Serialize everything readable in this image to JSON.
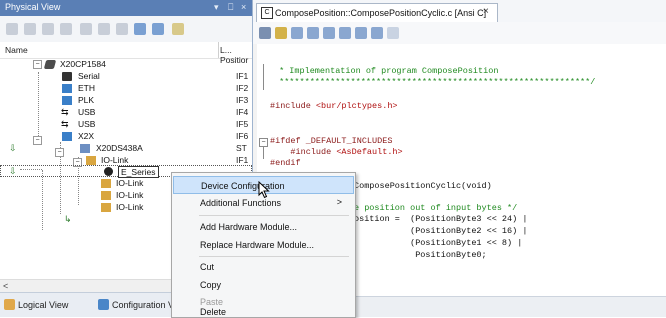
{
  "left_panel": {
    "title": "Physical View",
    "title_controls": [
      "▾",
      "⎕",
      "×"
    ],
    "columns": {
      "name": "Name",
      "position": "L... Positior"
    },
    "tree": [
      {
        "label": "X20CP1584",
        "pos": "",
        "icon": "cpu-icon"
      },
      {
        "label": "Serial",
        "pos": "IF1",
        "icon": "serial-port-icon"
      },
      {
        "label": "ETH",
        "pos": "IF2",
        "icon": "ethernet-icon"
      },
      {
        "label": "PLK",
        "pos": "IF3",
        "icon": "powerlink-icon"
      },
      {
        "label": "USB",
        "pos": "IF4",
        "icon": "usb-icon"
      },
      {
        "label": "USB",
        "pos": "IF5",
        "icon": "usb-icon"
      },
      {
        "label": "X2X",
        "pos": "IF6",
        "icon": "x2x-bus-icon"
      },
      {
        "label": "X20DS438A",
        "pos": "ST",
        "icon": "module-icon"
      },
      {
        "label": "IO-Link",
        "pos": "IF1",
        "icon": "io-link-icon"
      },
      {
        "label": "E_Series",
        "pos": "",
        "icon": "device-icon"
      },
      {
        "label": "IO-Link",
        "pos": "",
        "icon": "io-link-icon"
      },
      {
        "label": "IO-Link",
        "pos": "",
        "icon": "io-link-icon"
      },
      {
        "label": "IO-Link",
        "pos": "",
        "icon": "io-link-icon"
      }
    ],
    "bottom_tabs": [
      {
        "label": "Logical View",
        "icon": "logical-view-icon"
      },
      {
        "label": "Configuration View",
        "icon": "configuration-view-icon"
      }
    ]
  },
  "editor": {
    "tab_title": "ComposePosition::ComposePositionCyclic.c [Ansi C]",
    "tab_close": "×",
    "code": {
      "line1": " * Implementation of program ComposePosition",
      "line2": " *************************************************************/",
      "include1_kw": "#include ",
      "include1_file": "<bur/plctypes.h>",
      "ifdef": "#ifdef _DEFAULT_INCLUDES",
      "include2_kw": "    #include ",
      "include2_file": "<AsDefault.h>",
      "endif": "#endif",
      "func": "ComposePositionCyclic(void)",
      "comment2": "e position out of input bytes */",
      "assign": "osition =  (PositionByte3 << 24) |",
      "cont1": "           (PositionByte2 << 16) |",
      "cont2": "           (PositionByte1 << 8) |",
      "cont3": "            PositionByte0;"
    }
  },
  "context_menu": {
    "items": [
      {
        "label": "Device Configuration",
        "highlighted": true,
        "disabled": false
      },
      {
        "label": "Additional Functions",
        "submenu_arrow": ">"
      },
      {
        "label": "Add Hardware Module..."
      },
      {
        "label": "Replace Hardware Module..."
      },
      {
        "label": "Cut"
      },
      {
        "label": "Copy"
      },
      {
        "label": "Paste",
        "disabled": true
      },
      {
        "label": "Delete"
      }
    ]
  },
  "colors": {
    "title_bar": "#5a7fb5",
    "menu_highlight": "#cfe4fb",
    "comment": "#1f8a1f",
    "preprocessor": "#8b1a1a",
    "string": "#b01010"
  }
}
